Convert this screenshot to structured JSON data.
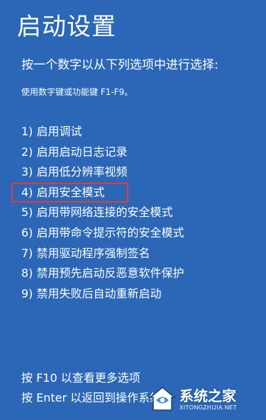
{
  "screen": {
    "title": "启动设置",
    "prompt": "按一个数字以从下列选项中进行选择:",
    "hint": "使用数字键或功能键 F1-F9。"
  },
  "options": [
    {
      "label": "1) 启用调试"
    },
    {
      "label": "2) 启用启动日志记录"
    },
    {
      "label": "3) 启用低分辨率视频"
    },
    {
      "label": "4) 启用安全模式"
    },
    {
      "label": "5) 启用带网络连接的安全模式"
    },
    {
      "label": "6) 启用带命令提示符的安全模式"
    },
    {
      "label": "7) 禁用驱动程序强制签名"
    },
    {
      "label": "8) 禁用预先启动反恶意软件保护"
    },
    {
      "label": "9) 禁用失败后自动重新启动"
    }
  ],
  "footer": {
    "more_options": "按 F10 以查看更多选项",
    "return": "按 Enter 以返回到操作系统"
  },
  "watermark": {
    "name": "系统之家",
    "url": "XITONGZHIJIA.NET"
  },
  "colors": {
    "background": "#2b67b6",
    "text": "#ffffff",
    "highlight_border": "#e43a3a"
  }
}
